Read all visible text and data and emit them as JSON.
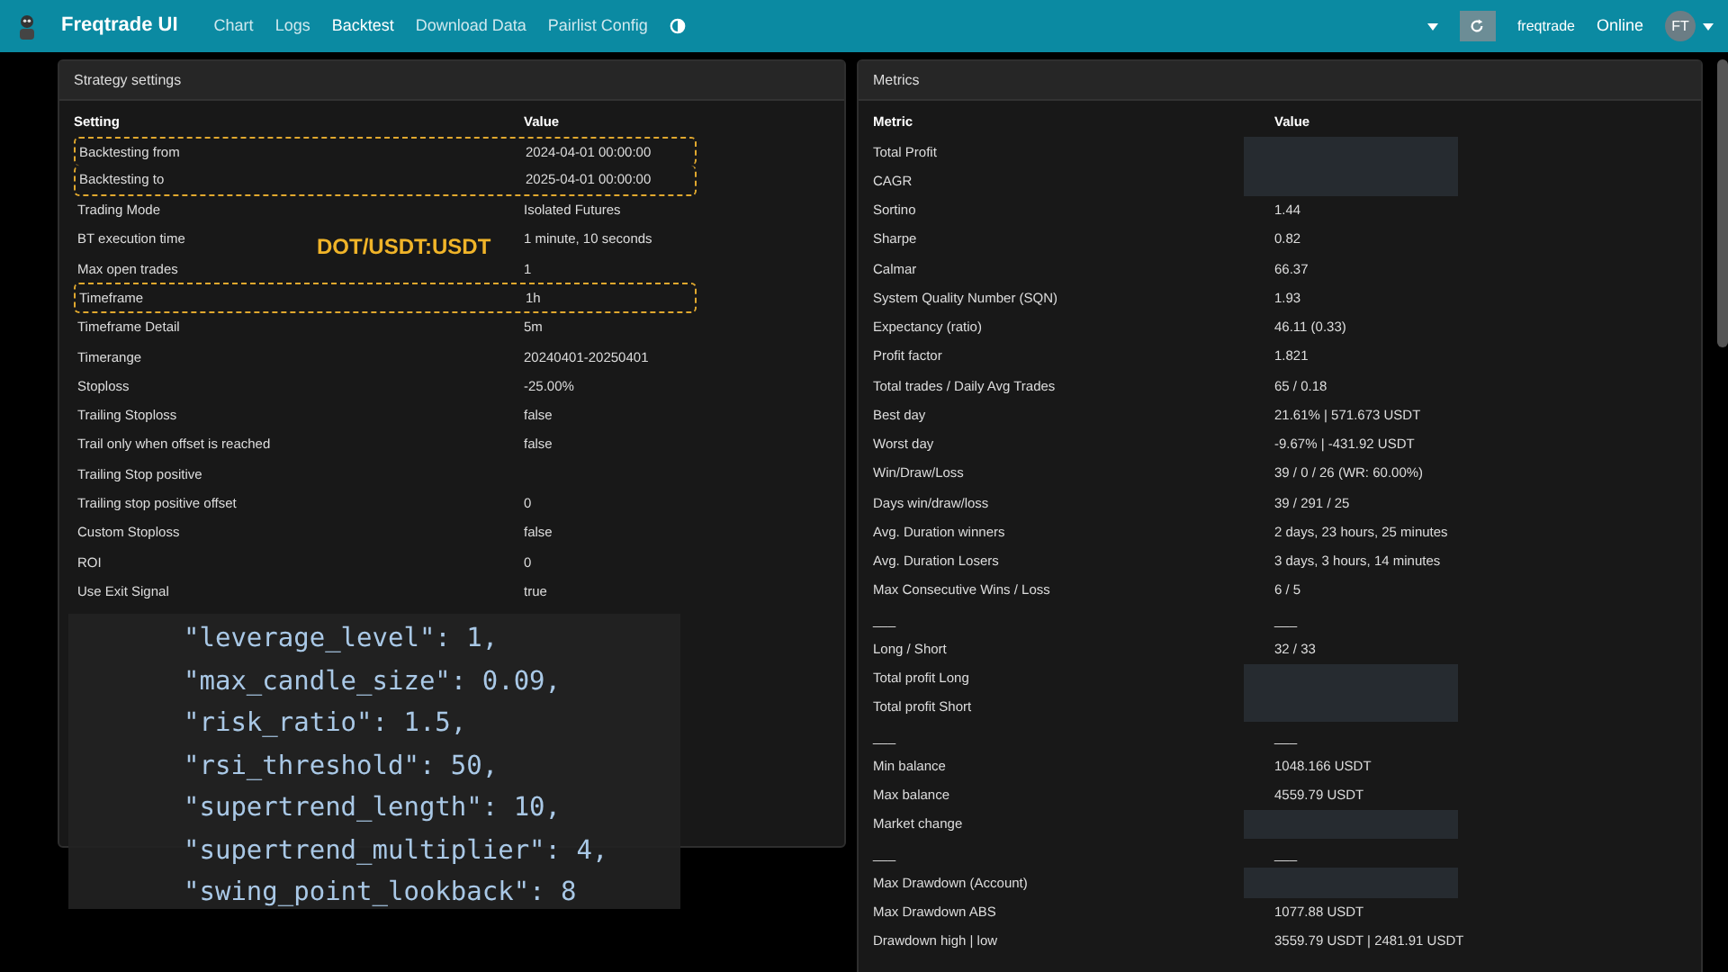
{
  "navbar": {
    "brand": "Freqtrade UI",
    "links": [
      {
        "label": "Chart",
        "selected": false
      },
      {
        "label": "Logs",
        "selected": false
      },
      {
        "label": "Backtest",
        "selected": true
      },
      {
        "label": "Download Data",
        "selected": false
      },
      {
        "label": "Pairlist Config",
        "selected": false
      }
    ],
    "bot_name": "freqtrade",
    "status": "Online",
    "avatar": "FT"
  },
  "strategy_settings": {
    "title": "Strategy settings",
    "columns": [
      "Setting",
      "Value"
    ],
    "rows": [
      {
        "setting": "Backtesting from",
        "value": "2024-04-01 00:00:00",
        "highlighted": true
      },
      {
        "setting": "Backtesting to",
        "value": "2025-04-01 00:00:00",
        "highlighted": true
      },
      {
        "setting": "Trading Mode",
        "value": "Isolated Futures",
        "highlighted": false
      },
      {
        "setting": "BT execution time",
        "value": "1 minute, 10 seconds",
        "highlighted": false
      },
      {
        "setting": "Max open trades",
        "value": "1",
        "highlighted": false
      },
      {
        "setting": "Timeframe",
        "value": "1h",
        "highlighted": true
      },
      {
        "setting": "Timeframe Detail",
        "value": "5m",
        "highlighted": false
      },
      {
        "setting": "Timerange",
        "value": "20240401-20250401",
        "highlighted": false
      },
      {
        "setting": "Stoploss",
        "value": "-25.00%",
        "highlighted": false
      },
      {
        "setting": "Trailing Stoploss",
        "value": "false",
        "highlighted": false
      },
      {
        "setting": "Trail only when offset is reached",
        "value": "false",
        "highlighted": false
      },
      {
        "setting": "Trailing Stop positive",
        "value": "",
        "highlighted": false
      },
      {
        "setting": "Trailing stop positive offset",
        "value": "0",
        "highlighted": false
      },
      {
        "setting": "Custom Stoploss",
        "value": "false",
        "highlighted": false
      },
      {
        "setting": "ROI",
        "value": "0",
        "highlighted": false
      },
      {
        "setting": "Use Exit Signal",
        "value": "true",
        "highlighted": false
      }
    ],
    "annotation": "DOT/USDT:USDT"
  },
  "code_overlay": {
    "lines": [
      "\"leverage_level\": 1,",
      "\"max_candle_size\": 0.09,",
      "\"risk_ratio\": 1.5,",
      "\"rsi_threshold\": 50,",
      "\"supertrend_length\": 10,",
      "\"supertrend_multiplier\": 4,",
      "\"swing_point_lookback\": 8"
    ]
  },
  "metrics": {
    "title": "Metrics",
    "columns": [
      "Metric",
      "Value"
    ],
    "rows": [
      {
        "metric": "Total Profit",
        "value": "",
        "redacted": true
      },
      {
        "metric": "CAGR",
        "value": "",
        "redacted": true
      },
      {
        "metric": "Sortino",
        "value": "1.44",
        "redacted": false
      },
      {
        "metric": "Sharpe",
        "value": "0.82",
        "redacted": false
      },
      {
        "metric": "Calmar",
        "value": "66.37",
        "redacted": false
      },
      {
        "metric": "System Quality Number (SQN)",
        "value": "1.93",
        "redacted": false
      },
      {
        "metric": "Expectancy (ratio)",
        "value": "46.11 (0.33)",
        "redacted": false
      },
      {
        "metric": "Profit factor",
        "value": "1.821",
        "redacted": false
      },
      {
        "metric": "Total trades / Daily Avg Trades",
        "value": "65 / 0.18",
        "redacted": false
      },
      {
        "metric": "Best day",
        "value": "21.61% | 571.673 USDT",
        "redacted": false
      },
      {
        "metric": "Worst day",
        "value": "-9.67% | -431.92 USDT",
        "redacted": false
      },
      {
        "metric": "Win/Draw/Loss",
        "value": "39 / 0 / 26 (WR: 60.00%)",
        "redacted": false
      },
      {
        "metric": "Days win/draw/loss",
        "value": "39 / 291 / 25",
        "redacted": false
      },
      {
        "metric": "Avg. Duration winners",
        "value": "2 days, 23 hours, 25 minutes",
        "redacted": false
      },
      {
        "metric": "Avg. Duration Losers",
        "value": "3 days, 3 hours, 14 minutes",
        "redacted": false
      },
      {
        "metric": "Max Consecutive Wins / Loss",
        "value": "6 / 5",
        "redacted": false
      },
      {
        "metric": "___",
        "value": "___",
        "redacted": false
      },
      {
        "metric": "Long / Short",
        "value": "32 / 33",
        "redacted": false
      },
      {
        "metric": "Total profit Long",
        "value": "",
        "redacted": true
      },
      {
        "metric": "Total profit Short",
        "value": "",
        "redacted": true
      },
      {
        "metric": "___",
        "value": "___",
        "redacted": false
      },
      {
        "metric": "Min balance",
        "value": "1048.166 USDT",
        "redacted": false
      },
      {
        "metric": "Max balance",
        "value": "4559.79 USDT",
        "redacted": false
      },
      {
        "metric": "Market change",
        "value": "",
        "redacted": true
      },
      {
        "metric": "___",
        "value": "___",
        "redacted": false
      },
      {
        "metric": "Max Drawdown (Account)",
        "value": "",
        "redacted": true
      },
      {
        "metric": "Max Drawdown ABS",
        "value": "1077.88 USDT",
        "redacted": false
      },
      {
        "metric": "Drawdown high | low",
        "value": "3559.79 USDT | 2481.91 USDT",
        "redacted": false
      }
    ]
  }
}
